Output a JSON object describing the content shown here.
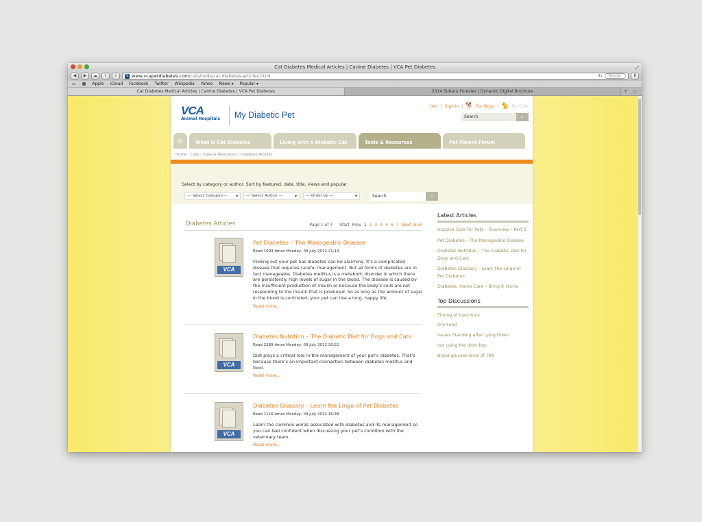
{
  "browser": {
    "window_title": "Cat Diabetes Medical Articles | Canine Diabetes | VCA Pet Diabetes",
    "url_domain": "www.vcapetdiabetes.com",
    "url_path": "/cats/tools/cat-diabetes-articles.html",
    "reader_label": "Reader",
    "bookmarks": [
      "Apple",
      "iCloud",
      "Facebook",
      "Twitter",
      "Wikipedia",
      "Yahoo",
      "News ▾",
      "Popular ▾"
    ],
    "tabs": [
      "Cat Diabetes Medical Articles | Canine Diabetes | VCA Pet Diabetes",
      "2014 Subaru Forester | Dynamic Digital Brochure"
    ]
  },
  "site": {
    "logo_text": "VCA",
    "logo_sub": "Animal Hospitals",
    "title": "My Diabetic Pet",
    "top_links": {
      "join": "Join",
      "signin": "Sign in",
      "dogs": "For Dogs",
      "cats": "For Cats"
    },
    "search_placeholder": "Search"
  },
  "nav": {
    "tabs": [
      "What is Cat Diabetes",
      "Living with a Diabetic Cat",
      "Tools & Resources",
      "Pet Parent Forum"
    ]
  },
  "breadcrumb": "Home › Cats › Tools & Resources › Diabetes Articles",
  "filter": {
    "instructions": "Select by category or author. Sort by featured, date, title, views and popular",
    "category": "--- Select Category --",
    "author": "--- Select Author ---",
    "order": "--- Order by ---",
    "search_placeholder": "Search"
  },
  "main": {
    "heading": "Diabetes Articles",
    "pager": {
      "page_of": "Page 1 of 7",
      "start": "Start",
      "prev": "Prev",
      "current": "1",
      "pages": [
        "2",
        "3",
        "4",
        "5",
        "6",
        "7"
      ],
      "next": "Next",
      "end": "End"
    },
    "articles": [
      {
        "title": "Pet Diabetes – The Manageable Disease",
        "meta": "Read 1093 times   Monday, 09 July 2012 21:13",
        "text": "Finding out your pet has diabetes can be alarming. It’s a complicated disease that requires careful management. But all forms of diabetes are in fact manageable. Diabetes mellitus is a metabolic disorder in which there are persistently high levels of sugar in the blood. The disease is caused by the insufficient production of insulin or because the body’s cells are not responding to the insulin that is produced. So as long as the amount of sugar in the blood is controlled, your pet can live a long, happy life.",
        "more": "Read more..."
      },
      {
        "title": "Diabetes Nutrition – The Diabetic Diet for Dogs and Cats",
        "meta": "Read 2289 times   Monday, 09 July 2012 20:22",
        "text": "Diet plays a critical role in the management of your pet’s diabetes. That’s because there’s an important connection between diabetes mellitus and food.",
        "more": "Read more..."
      },
      {
        "title": "Diabetes Glossary – Learn the Lingo of Pet Diabetes",
        "meta": "Read 1116 times   Monday, 09 July 2012 16:38",
        "text": "Learn the common words associated with diabetes and its management so you can feel confident when discussing your pet’s condition with the veterinary team.",
        "more": "Read more..."
      }
    ]
  },
  "sidebar": {
    "latest_heading": "Latest Articles",
    "latest": [
      "Hospice Care for Pets – Overview – Part 2",
      "Pet Diabetes – The Manageable Disease",
      "Diabetes Nutrition – The Diabetic Diet for Dogs and Cats",
      "Diabetes Glossary – Learn the Lingo of Pet Diabetes",
      "Diabetes: Home Care – Bring It Home"
    ],
    "discussions_heading": "Top Discussions",
    "discussions": [
      "Timing of Injections",
      "Dry Food",
      "Issues Standing after Lying Down",
      "not using the litter box",
      "Blood glucose level of 784"
    ]
  },
  "colors": {
    "accent": "#e67e1e",
    "brand": "#1d59a6",
    "olive": "#9c8e58"
  }
}
